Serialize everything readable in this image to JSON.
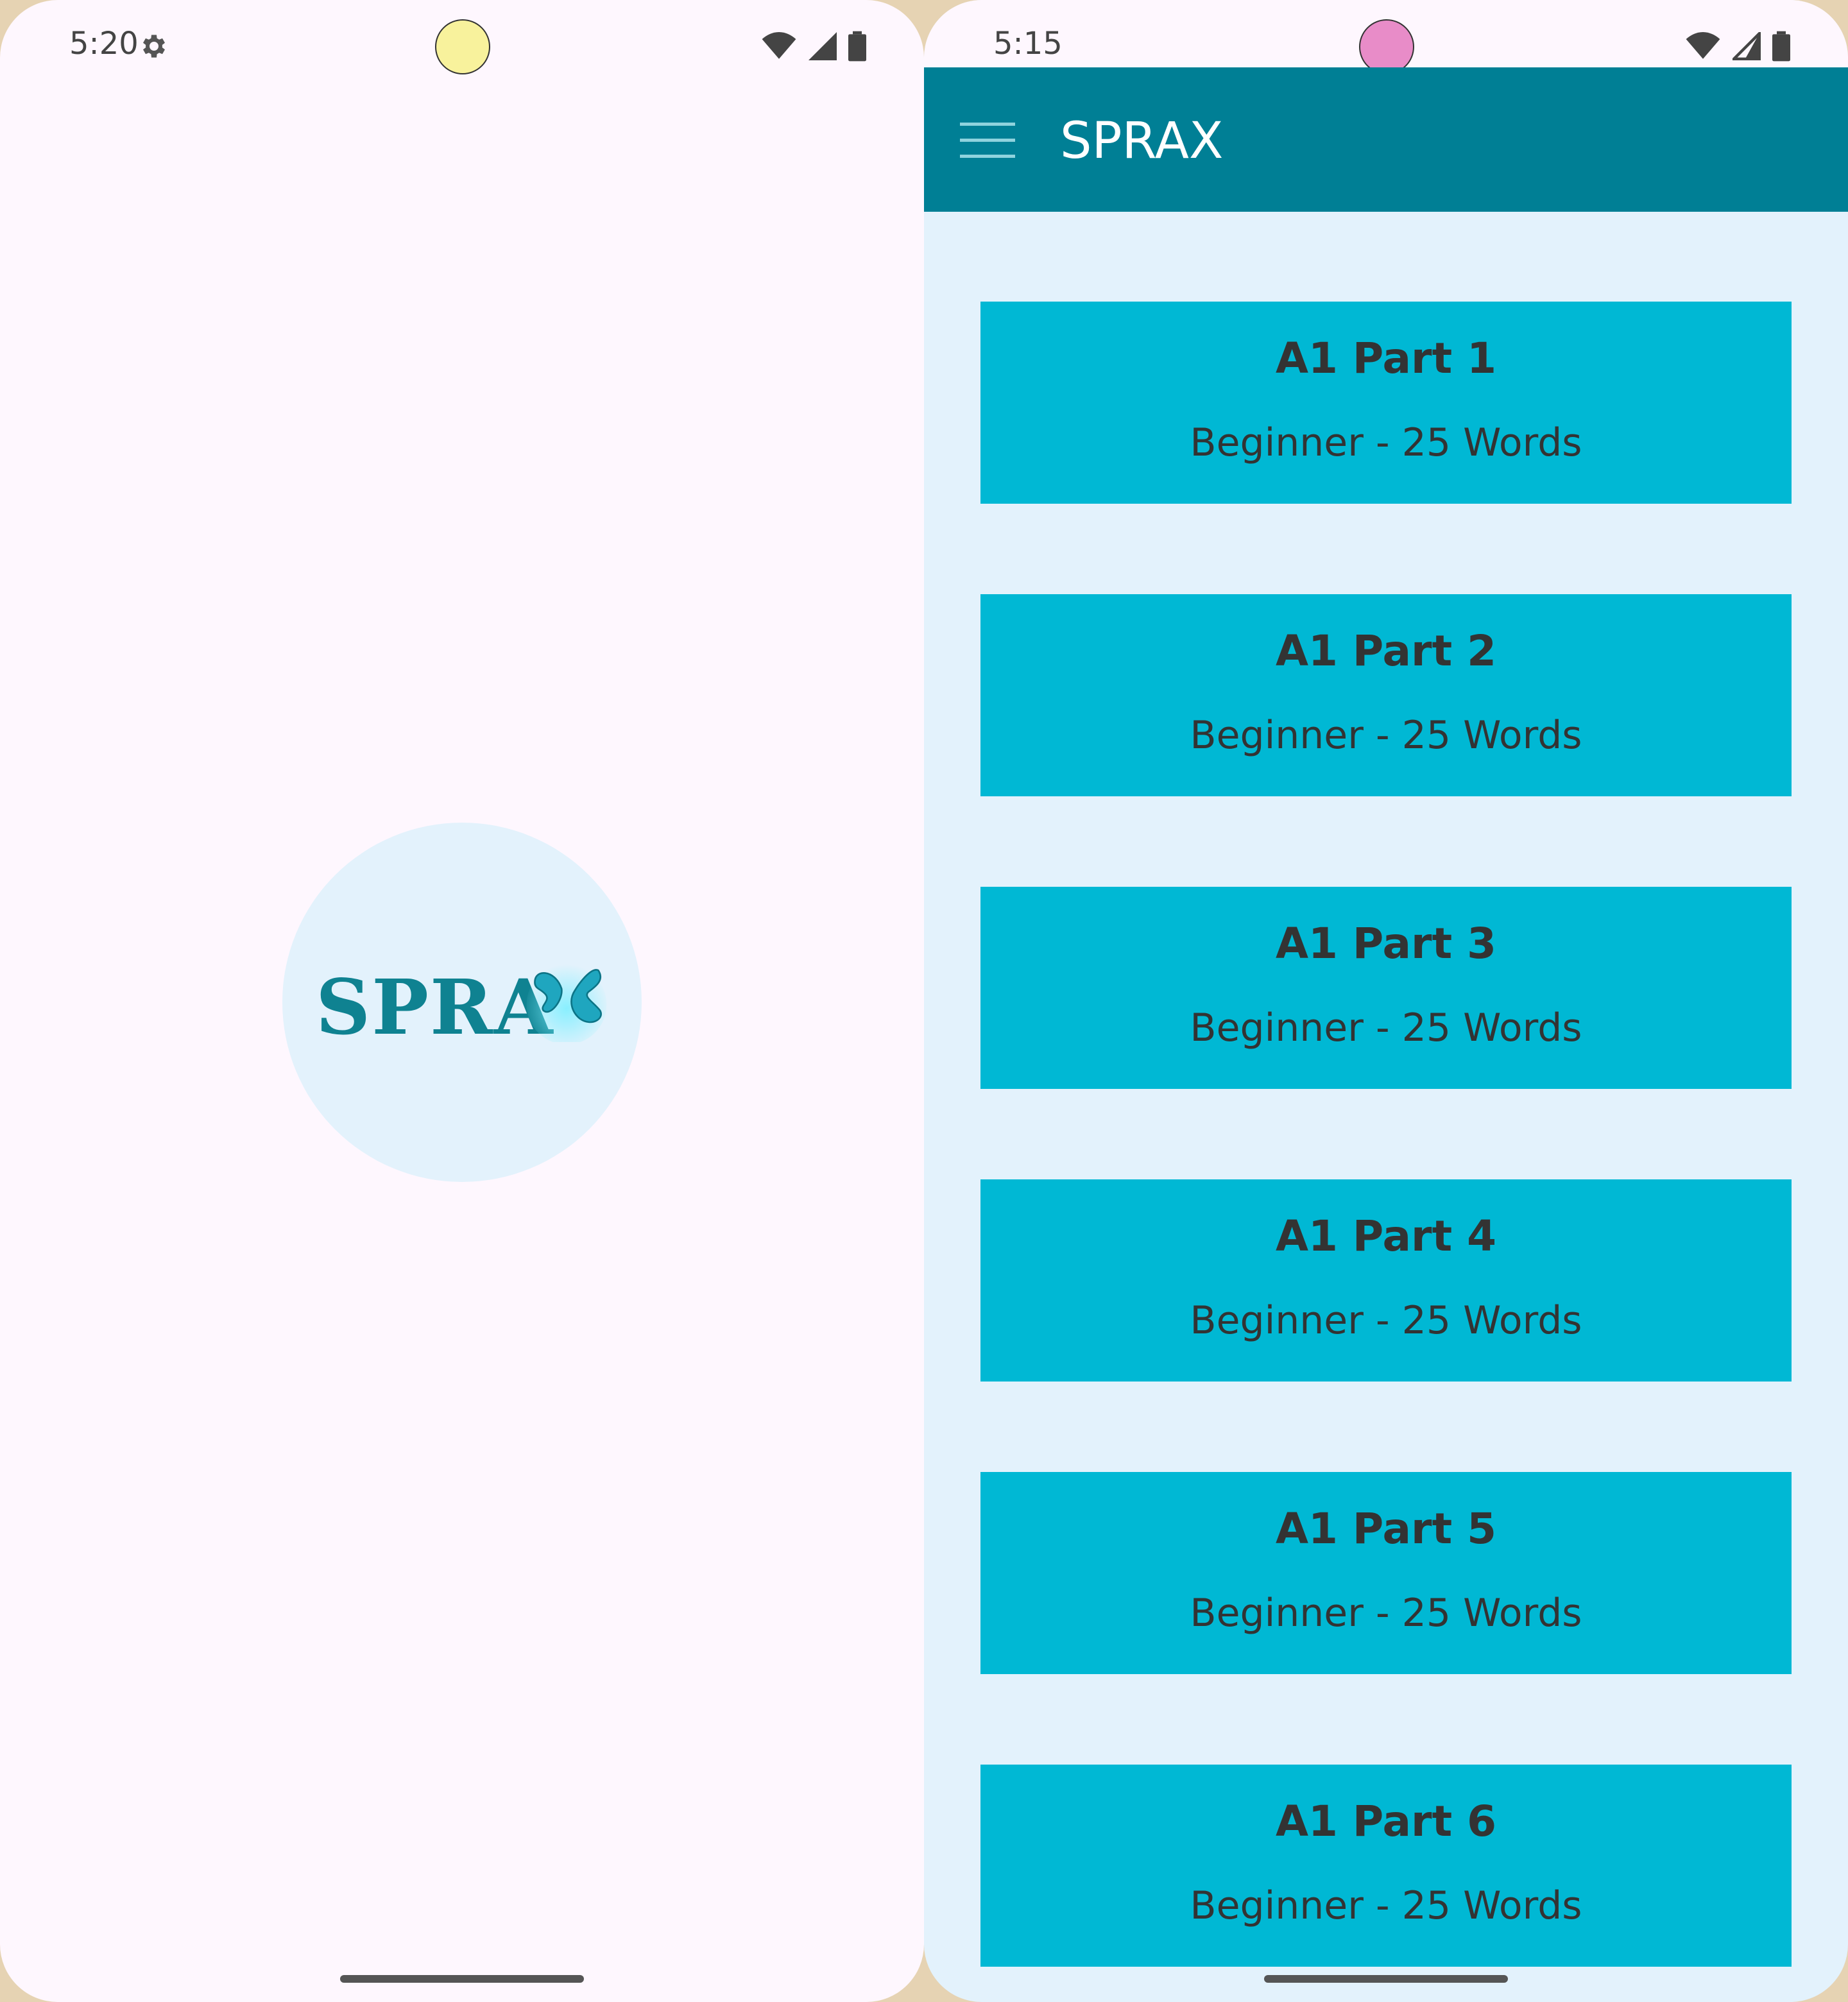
{
  "left_screen": {
    "status_time": "5:20",
    "camera_dot_color": "#F8F29C",
    "logo_text": "SPRA",
    "logo_circle_color": "#E3F2FC",
    "background": "#FEF7FE"
  },
  "right_screen": {
    "status_time": "5:15",
    "camera_dot_color": "#E88CC8",
    "app_title": "SPRAX",
    "app_bar_color": "#007F95",
    "card_color": "#00B8D4",
    "lessons": [
      {
        "title": "A1 Part 1",
        "subtitle": "Beginner - 25 Words"
      },
      {
        "title": "A1 Part 2",
        "subtitle": "Beginner - 25 Words"
      },
      {
        "title": "A1 Part 3",
        "subtitle": "Beginner - 25 Words"
      },
      {
        "title": "A1 Part 4",
        "subtitle": "Beginner - 25 Words"
      },
      {
        "title": "A1 Part 5",
        "subtitle": "Beginner - 25 Words"
      },
      {
        "title": "A1 Part 6",
        "subtitle": "Beginner - 25 Words"
      }
    ]
  },
  "icons": {
    "settings": "gear-icon",
    "wifi": "wifi-icon",
    "signal": "signal-icon",
    "battery": "battery-icon",
    "menu": "hamburger-menu-icon"
  }
}
